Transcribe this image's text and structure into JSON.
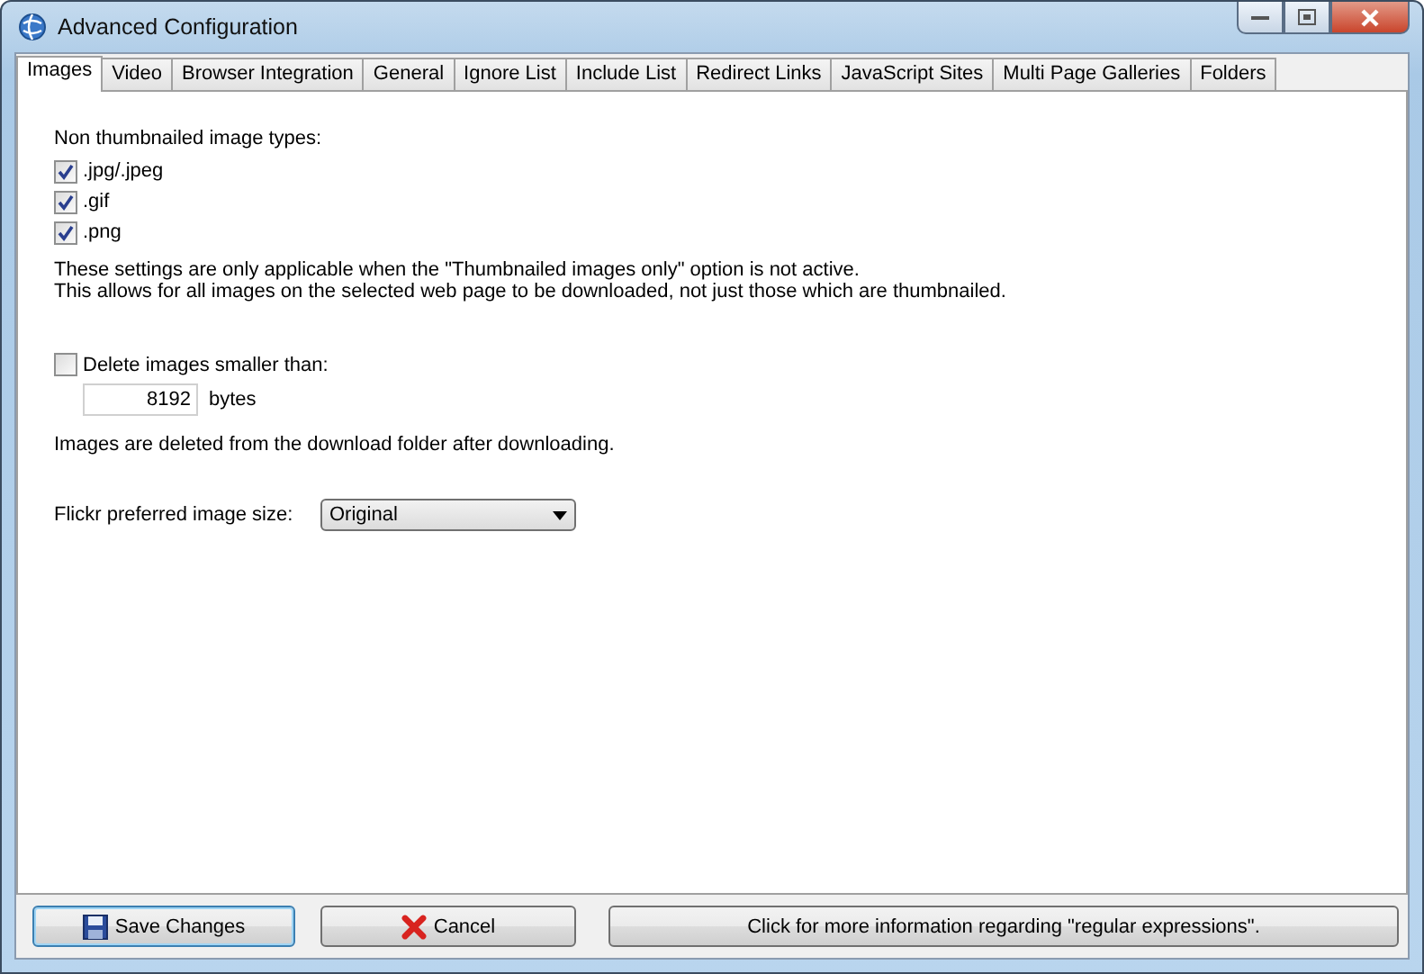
{
  "window": {
    "title": "Advanced Configuration"
  },
  "tabs": [
    {
      "label": "Images",
      "selected": true
    },
    {
      "label": "Video",
      "selected": false
    },
    {
      "label": "Browser Integration",
      "selected": false
    },
    {
      "label": "General",
      "selected": false
    },
    {
      "label": "Ignore List",
      "selected": false
    },
    {
      "label": "Include List",
      "selected": false
    },
    {
      "label": "Redirect Links",
      "selected": false
    },
    {
      "label": "JavaScript Sites",
      "selected": false
    },
    {
      "label": "Multi Page Galleries",
      "selected": false
    },
    {
      "label": "Folders",
      "selected": false
    }
  ],
  "image_types": {
    "label": "Non thumbnailed image types:",
    "options": [
      {
        "label": ".jpg/.jpeg",
        "checked": true
      },
      {
        "label": ".gif",
        "checked": true
      },
      {
        "label": ".png",
        "checked": true
      }
    ]
  },
  "notes": [
    "These settings are only applicable when the \"Thumbnailed images only\" option is not active.",
    "This allows for all images on the selected web page to be downloaded, not just those which are thumbnailed."
  ],
  "delete_small": {
    "label": "Delete images smaller than:",
    "checked": false,
    "value": "8192",
    "unit": "bytes",
    "note": "Images are deleted from the download folder after downloading."
  },
  "flickr": {
    "label": "Flickr preferred image size:",
    "value": "Original"
  },
  "buttons": [
    {
      "kind": "save",
      "label": "Save Changes"
    },
    {
      "kind": "cancel",
      "label": "Cancel"
    },
    {
      "kind": "info",
      "label": "Click for more information regarding \"regular expressions\"."
    }
  ]
}
